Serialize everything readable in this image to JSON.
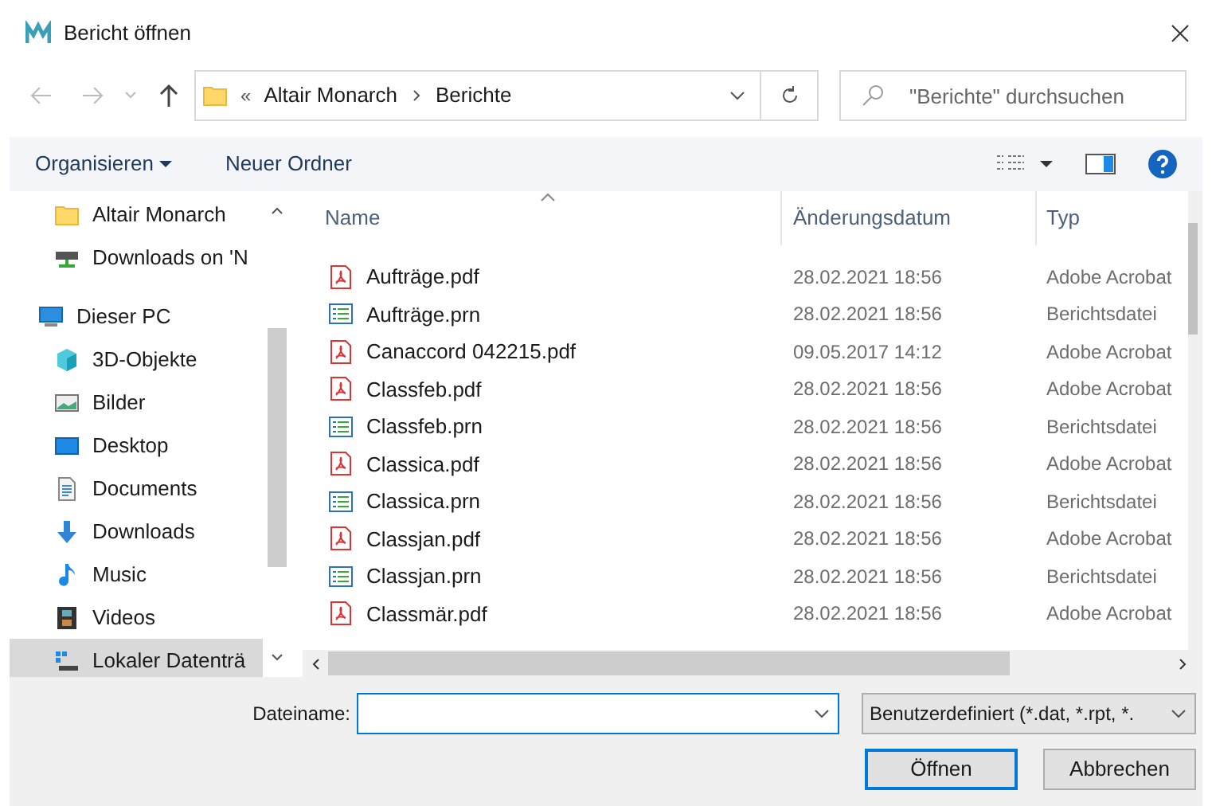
{
  "window": {
    "title": "Bericht öffnen"
  },
  "address": {
    "overflow": "«",
    "path": [
      "Altair Monarch",
      "Berichte"
    ]
  },
  "search": {
    "placeholder": "\"Berichte\" durchsuchen"
  },
  "toolbar": {
    "organize": "Organisieren",
    "new_folder": "Neuer Ordner"
  },
  "nav": {
    "items": [
      {
        "children": [
          {
            "label": "Altair Monarch",
            "kind": "folder",
            "selected": false
          },
          {
            "label": "Downloads on 'N",
            "kind": "network",
            "selected": false
          }
        ]
      },
      {
        "label": "Dieser PC",
        "kind": "pc",
        "selected": false,
        "children": [
          {
            "label": "3D-Objekte",
            "kind": "cube",
            "selected": false
          },
          {
            "label": "Bilder",
            "kind": "pictures",
            "selected": false
          },
          {
            "label": "Desktop",
            "kind": "desktop",
            "selected": false
          },
          {
            "label": "Documents",
            "kind": "documents",
            "selected": false
          },
          {
            "label": "Downloads",
            "kind": "downloads",
            "selected": false
          },
          {
            "label": "Music",
            "kind": "music",
            "selected": false
          },
          {
            "label": "Videos",
            "kind": "videos",
            "selected": false
          },
          {
            "label": "Lokaler Datenträ",
            "kind": "drive",
            "selected": true
          }
        ]
      }
    ]
  },
  "table": {
    "columns": [
      "Name",
      "Änderungsdatum",
      "Typ"
    ],
    "rows": [
      {
        "name": "Aufträge.pdf",
        "date": "28.02.2021 18:56",
        "type": "Adobe Acrobat",
        "kind": "pdf"
      },
      {
        "name": "Aufträge.prn",
        "date": "28.02.2021 18:56",
        "type": "Berichtsdatei",
        "kind": "prn"
      },
      {
        "name": "Canaccord 042215.pdf",
        "date": "09.05.2017 14:12",
        "type": "Adobe Acrobat",
        "kind": "pdf"
      },
      {
        "name": "Classfeb.pdf",
        "date": "28.02.2021 18:56",
        "type": "Adobe Acrobat",
        "kind": "pdf"
      },
      {
        "name": "Classfeb.prn",
        "date": "28.02.2021 18:56",
        "type": "Berichtsdatei",
        "kind": "prn"
      },
      {
        "name": "Classica.pdf",
        "date": "28.02.2021 18:56",
        "type": "Adobe Acrobat",
        "kind": "pdf"
      },
      {
        "name": "Classica.prn",
        "date": "28.02.2021 18:56",
        "type": "Berichtsdatei",
        "kind": "prn"
      },
      {
        "name": "Classjan.pdf",
        "date": "28.02.2021 18:56",
        "type": "Adobe Acrobat",
        "kind": "pdf"
      },
      {
        "name": "Classjan.prn",
        "date": "28.02.2021 18:56",
        "type": "Berichtsdatei",
        "kind": "prn"
      },
      {
        "name": "Classmär.pdf",
        "date": "28.02.2021 18:56",
        "type": "Adobe Acrobat",
        "kind": "pdf"
      }
    ]
  },
  "filename": {
    "label": "Dateiname:"
  },
  "filter": {
    "value": "Benutzerdefiniert (*.dat, *.rpt, *."
  },
  "buttons": [
    {
      "label": "Öffnen",
      "kind": "primary"
    },
    {
      "label": "Abbrechen",
      "kind": "default"
    }
  ]
}
